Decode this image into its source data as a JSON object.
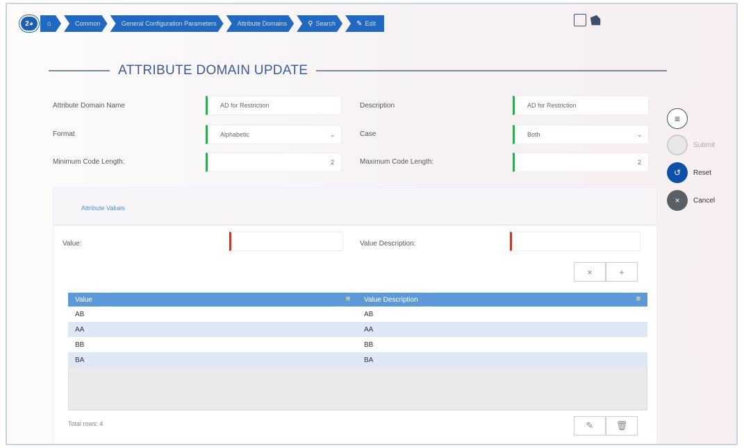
{
  "breadcrumb": {
    "badge": "2",
    "items": [
      {
        "label": "Common"
      },
      {
        "label": "General Configuration Parameters"
      },
      {
        "label": "Attribute Domains"
      },
      {
        "label": "Search",
        "icon": "search-icon"
      },
      {
        "label": "Edit",
        "icon": "edit-icon"
      }
    ]
  },
  "page": {
    "title": "ATTRIBUTE DOMAIN UPDATE"
  },
  "form": {
    "attribute_domain_name_label": "Attribute Domain Name",
    "attribute_domain_name_value": "AD for Restriction",
    "description_label": "Description",
    "description_value": "AD for Restriction",
    "format_label": "Format",
    "format_value": "Alphabetic",
    "case_label": "Case",
    "case_value": "Both",
    "min_code_length_label": "Minimum Code Length:",
    "min_code_length_value": "2",
    "max_code_length_label": "Maximum Code Length:",
    "max_code_length_value": "2"
  },
  "actions": {
    "submit": "Submit",
    "reset": "Reset",
    "cancel": "Cancel"
  },
  "panel": {
    "title": "Attribute Values",
    "value_label": "Value:",
    "value_input": "",
    "value_description_label": "Value Description:",
    "value_description_input": "",
    "clear_btn": "×",
    "add_btn": "+",
    "columns": [
      "Value",
      "Value Description"
    ],
    "rows": [
      [
        "AB",
        "AB"
      ],
      [
        "AA",
        "AA"
      ],
      [
        "BB",
        "BB"
      ],
      [
        "BA",
        "BA"
      ]
    ],
    "total_rows": "Total rows: 4",
    "edit_btn": "✎",
    "delete_btn": "🗑"
  },
  "colors": {
    "accent": "#2068c0",
    "required_ok": "#2fa84f",
    "required_missing": "#c0392b",
    "grid_header": "#5b9ad6"
  }
}
